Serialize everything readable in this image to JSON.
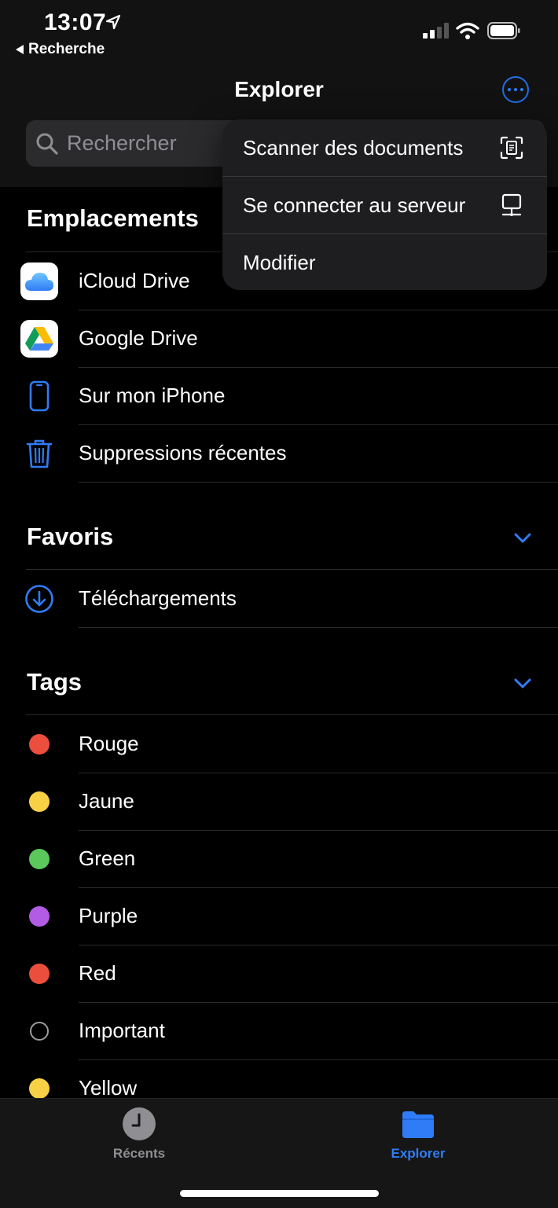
{
  "status": {
    "time": "13:07",
    "back_label": "Recherche"
  },
  "header": {
    "title": "Explorer",
    "search_placeholder": "Rechercher"
  },
  "menu": {
    "items": [
      {
        "label": "Scanner des documents",
        "icon": "scan-document-icon"
      },
      {
        "label": "Se connecter au serveur",
        "icon": "server-icon"
      },
      {
        "label": "Modifier"
      }
    ]
  },
  "sections": {
    "locations": {
      "title": "Emplacements",
      "items": [
        {
          "label": "iCloud Drive",
          "icon": "icloud-icon"
        },
        {
          "label": "Google Drive",
          "icon": "google-drive-icon"
        },
        {
          "label": "Sur mon iPhone",
          "icon": "iphone-icon"
        },
        {
          "label": "Suppressions récentes",
          "icon": "trash-icon"
        }
      ]
    },
    "favorites": {
      "title": "Favoris",
      "items": [
        {
          "label": "Téléchargements",
          "icon": "download-icon"
        }
      ]
    },
    "tags": {
      "title": "Tags",
      "items": [
        {
          "label": "Rouge",
          "color": "#eb4e3d"
        },
        {
          "label": "Jaune",
          "color": "#f7d046"
        },
        {
          "label": "Green",
          "color": "#5ac85a"
        },
        {
          "label": "Purple",
          "color": "#b25ce6"
        },
        {
          "label": "Red",
          "color": "#eb4e3d"
        },
        {
          "label": "Important",
          "color": ""
        },
        {
          "label": "Yellow",
          "color": "#f7d046"
        }
      ]
    }
  },
  "tabbar": {
    "tabs": [
      {
        "label": "Récents",
        "active": false
      },
      {
        "label": "Explorer",
        "active": true
      }
    ],
    "active_color": "#2f7cf6",
    "inactive_color": "#8e8e93"
  }
}
